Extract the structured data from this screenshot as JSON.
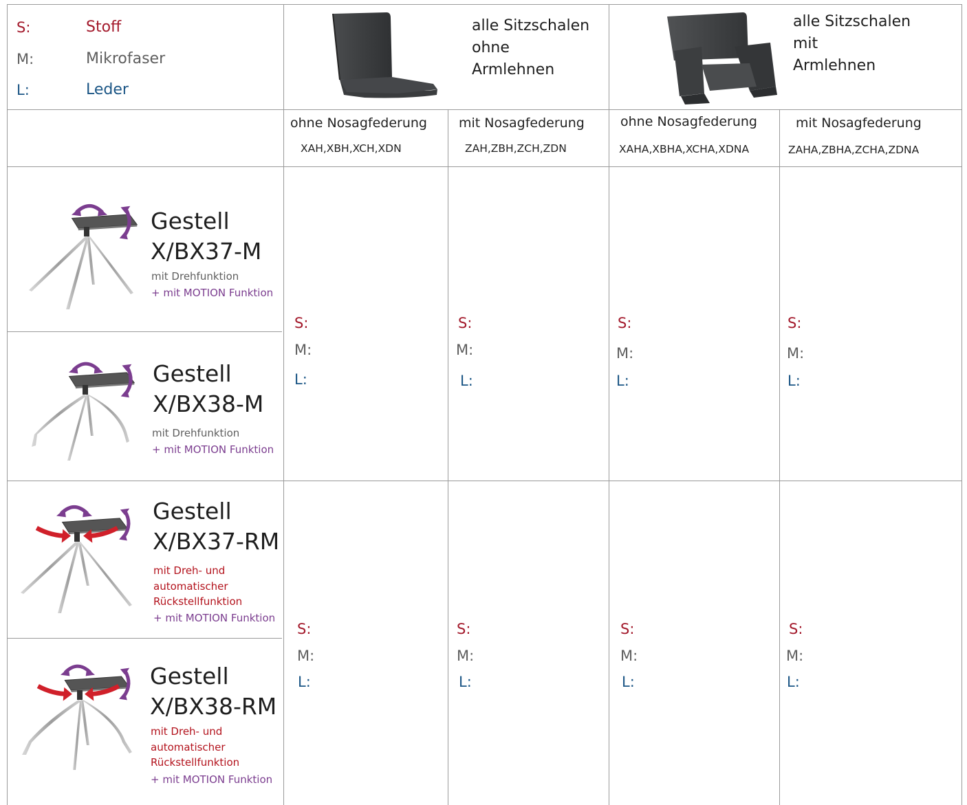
{
  "legend": [
    {
      "key": "S:",
      "label": "Stoff",
      "color": "#a3192b"
    },
    {
      "key": "M:",
      "label": "Mikrofaser",
      "color": "#5e5e5e"
    },
    {
      "key": "L:",
      "label": "Leder",
      "color": "#1a5585"
    }
  ],
  "shells": [
    {
      "lines": [
        "alle Sitzschalen",
        "ohne",
        "Armlehnen"
      ],
      "image": "chair-without-armrests"
    },
    {
      "lines": [
        "alle Sitzschalen",
        "mit",
        "Armlehnen"
      ],
      "image": "chair-with-armrests"
    }
  ],
  "columns": [
    {
      "label": "ohne  Nosagfederung",
      "codes": "XAH,XBH,XCH,XDN"
    },
    {
      "label": "mit Nosagfederung",
      "codes": "ZAH,ZBH,ZCH,ZDN"
    },
    {
      "label": "ohne Nosagfederung",
      "codes": "XAHA,XBHA,XCHA,XDNA"
    },
    {
      "label": "mit Nosagfederung",
      "codes": "ZAHA,ZBHA,ZCHA,ZDNA"
    }
  ],
  "frames": [
    {
      "title1": "Gestell",
      "title2": "X/BX37-M",
      "desc": [
        "mit Drehfunktion"
      ],
      "motion": "+ mit MOTION Funktion",
      "icon": "swivel-base-4-legs"
    },
    {
      "title1": "Gestell",
      "title2": "X/BX38-M",
      "desc": [
        "mit Drehfunktion"
      ],
      "motion": "+ mit MOTION Funktion",
      "icon": "swivel-base-4-curved-legs"
    },
    {
      "title1": "Gestell",
      "title2": "X/BX37-RM",
      "desc": [
        "mit Dreh- und",
        "automatischer",
        "Rückstellfunktion"
      ],
      "motion": "+ mit MOTION Funktion",
      "icon": "swivel-return-base-4-legs"
    },
    {
      "title1": "Gestell",
      "title2": "X/BX38-RM",
      "desc": [
        "mit Dreh- und",
        "automatischer",
        "Rückstellfunktion"
      ],
      "motion": "+ mit MOTION Funktion",
      "icon": "swivel-return-base-4-curved-legs"
    }
  ],
  "material_labels": {
    "s": "S:",
    "m": "M:",
    "l": "L:"
  },
  "colors": {
    "stoff": "#a3192b",
    "mikrofaser": "#5e5e5e",
    "leder": "#1a5585",
    "motion": "#7b3d8f",
    "return_function": "#b3121c"
  }
}
